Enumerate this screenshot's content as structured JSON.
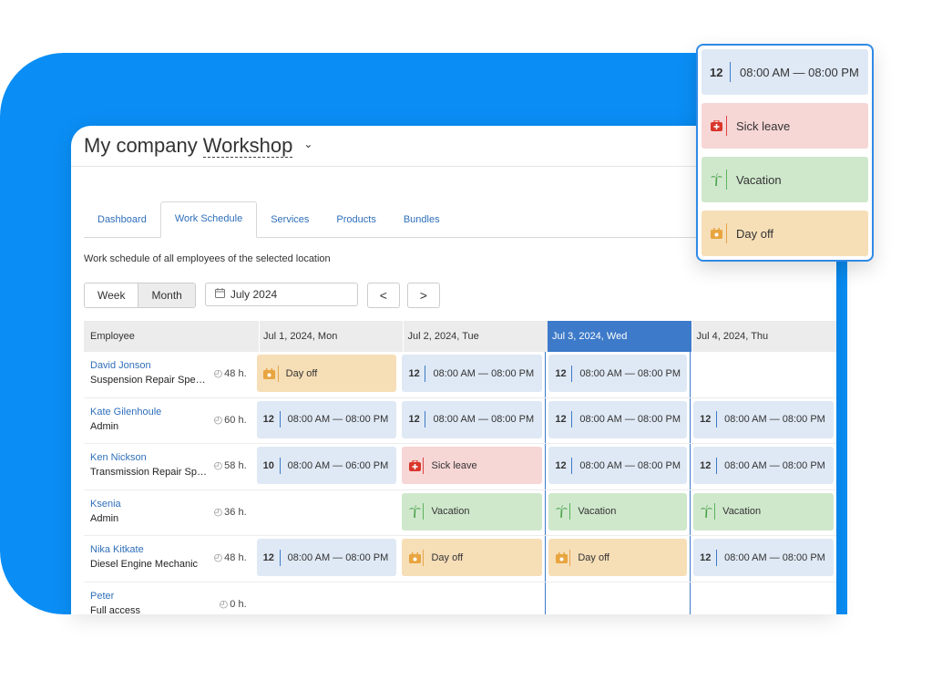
{
  "header": {
    "company": "My company",
    "location": "Workshop"
  },
  "tabs": [
    {
      "label": "Dashboard"
    },
    {
      "label": "Work Schedule"
    },
    {
      "label": "Services"
    },
    {
      "label": "Products"
    },
    {
      "label": "Bundles"
    }
  ],
  "subtitle": "Work schedule of all employees of the selected location",
  "view_toggle": {
    "week": "Week",
    "month": "Month"
  },
  "date_picker": {
    "value": "July 2024"
  },
  "nav": {
    "prev": "<",
    "next": ">"
  },
  "grid": {
    "employee_header": "Employee",
    "days": [
      "Jul 1, 2024, Mon",
      "Jul 2, 2024, Tue",
      "Jul 3, 2024, Wed",
      "Jul 4, 2024, Thu"
    ],
    "rows": [
      {
        "name": "David Jonson",
        "role": "Suspension Repair Speci...",
        "hours": "48 h.",
        "cells": [
          {
            "type": "off",
            "label": "Day off"
          },
          {
            "type": "shift",
            "num": "12",
            "label": "08:00 AM — 08:00 PM"
          },
          {
            "type": "shift",
            "num": "12",
            "label": "08:00 AM — 08:00 PM"
          },
          {
            "type": "empty"
          }
        ]
      },
      {
        "name": "Kate Gilenhoule",
        "role": "Admin",
        "hours": "60 h.",
        "cells": [
          {
            "type": "shift",
            "num": "12",
            "label": "08:00 AM — 08:00 PM"
          },
          {
            "type": "shift",
            "num": "12",
            "label": "08:00 AM — 08:00 PM"
          },
          {
            "type": "shift",
            "num": "12",
            "label": "08:00 AM — 08:00 PM"
          },
          {
            "type": "shift",
            "num": "12",
            "label": "08:00 AM — 08:00 PM"
          }
        ]
      },
      {
        "name": "Ken Nickson",
        "role": "Transmission Repair Spe...",
        "hours": "58 h.",
        "cells": [
          {
            "type": "shift",
            "num": "10",
            "label": "08:00 AM — 06:00 PM"
          },
          {
            "type": "sick",
            "label": "Sick leave"
          },
          {
            "type": "shift",
            "num": "12",
            "label": "08:00 AM — 08:00 PM"
          },
          {
            "type": "shift",
            "num": "12",
            "label": "08:00 AM — 08:00 PM"
          }
        ]
      },
      {
        "name": "Ksenia",
        "role": "Admin",
        "hours": "36 h.",
        "cells": [
          {
            "type": "empty"
          },
          {
            "type": "vac",
            "label": "Vacation"
          },
          {
            "type": "vac",
            "label": "Vacation"
          },
          {
            "type": "vac",
            "label": "Vacation"
          }
        ]
      },
      {
        "name": "Nika Kitkate",
        "role": "Diesel Engine Mechanic",
        "hours": "48 h.",
        "cells": [
          {
            "type": "shift",
            "num": "12",
            "label": "08:00 AM — 08:00 PM"
          },
          {
            "type": "off",
            "label": "Day off"
          },
          {
            "type": "off",
            "label": "Day off"
          },
          {
            "type": "shift",
            "num": "12",
            "label": "08:00 AM — 08:00 PM"
          }
        ]
      },
      {
        "name": "Peter",
        "role": "Full access",
        "hours": "0 h.",
        "cells": [
          {
            "type": "empty"
          },
          {
            "type": "empty"
          },
          {
            "type": "empty"
          },
          {
            "type": "empty"
          }
        ]
      }
    ]
  },
  "dropdown": {
    "items": [
      {
        "type": "shift",
        "num": "12",
        "label": "08:00 AM — 08:00 PM"
      },
      {
        "type": "sick",
        "label": "Sick leave"
      },
      {
        "type": "vac",
        "label": "Vacation"
      },
      {
        "type": "off",
        "label": "Day off"
      }
    ]
  },
  "colors": {
    "brand_blue": "#0a8ef5",
    "selected_column": "#3d7ac9",
    "shift": "#dfe9f5",
    "sick": "#f7d6d6",
    "vacation": "#cfe8cc",
    "day_off": "#f6deb7"
  }
}
